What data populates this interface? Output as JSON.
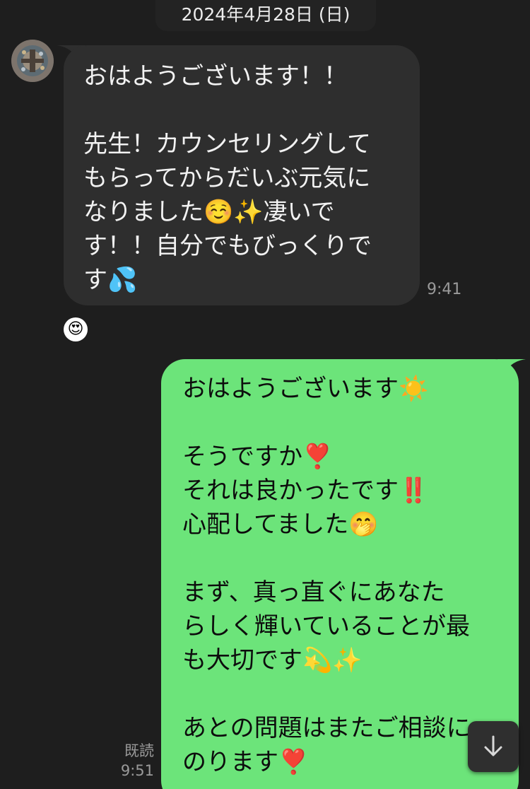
{
  "header": {
    "date": "2024年4月28日 (日)"
  },
  "incoming": {
    "text": "おはようございます！！\n\n先生！カウンセリングして\nもらってからだいぶ元気に\nなりました☺️✨凄いで\nす！！自分でもびっくりで\nす💦",
    "time": "9:41",
    "reaction": "😍"
  },
  "outgoing": {
    "text": "おはようございます☀️\n\nそうですか❣️\nそれは良かったです‼️\n心配してました🤭\n\nまず、真っ直ぐにあなた\nらしく輝いていることが最\nも大切です💫✨\n\nあとの問題はまたご相談に\nのります❣️",
    "read_label": "既読",
    "time": "9:51"
  },
  "icons": {
    "avatar": "avatar-image",
    "scroll": "arrow-down-icon"
  },
  "colors": {
    "background": "#1e1e1e",
    "incoming_bubble": "#2e2e2e",
    "outgoing_bubble": "#6ce47a"
  }
}
